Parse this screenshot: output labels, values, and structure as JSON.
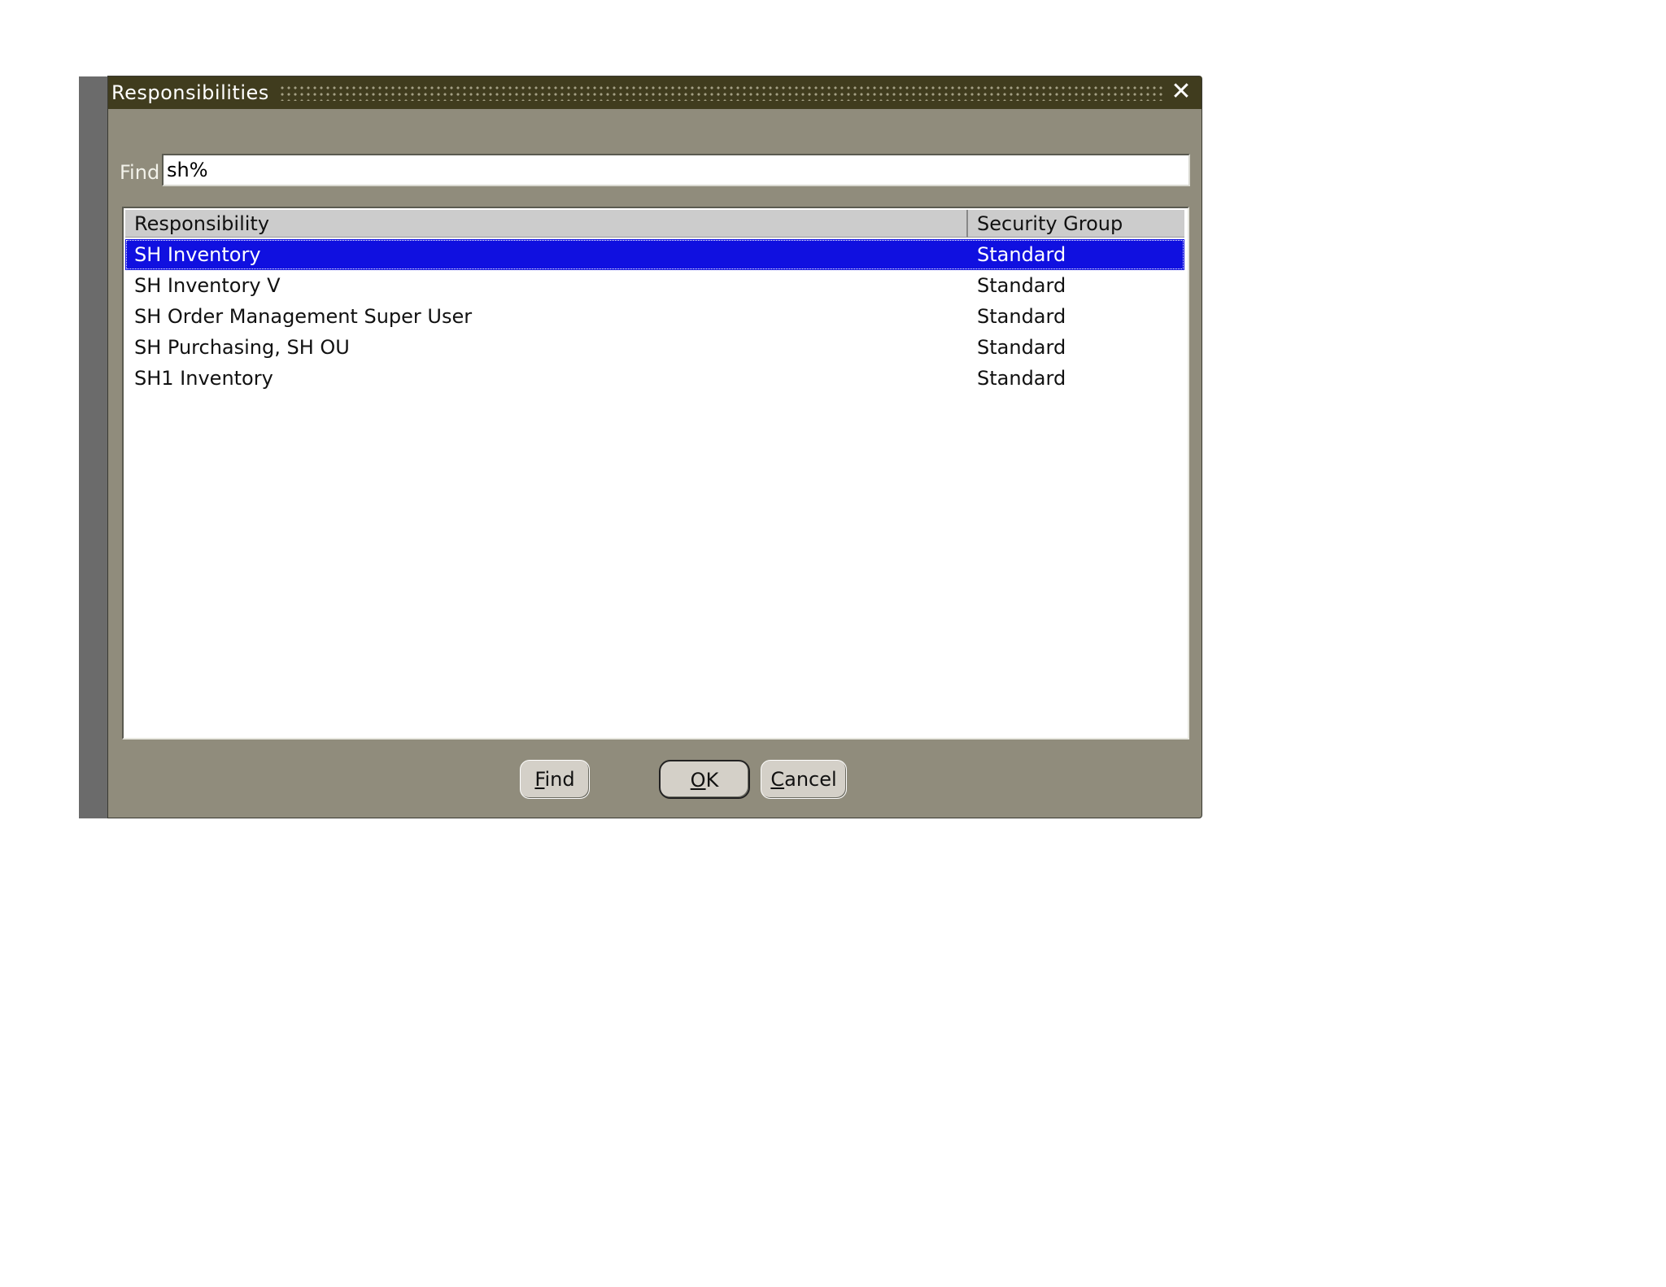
{
  "window": {
    "title": "Responsibilities",
    "close_glyph": "✕"
  },
  "find": {
    "label": "Find",
    "value": "sh%"
  },
  "table": {
    "columns": [
      "Responsibility",
      "Security Group"
    ],
    "rows": [
      {
        "responsibility": "SH Inventory",
        "security_group": "Standard",
        "selected": true
      },
      {
        "responsibility": "SH Inventory V",
        "security_group": "Standard",
        "selected": false
      },
      {
        "responsibility": "SH Order Management Super User",
        "security_group": "Standard",
        "selected": false
      },
      {
        "responsibility": "SH Purchasing, SH OU",
        "security_group": "Standard",
        "selected": false
      },
      {
        "responsibility": "SH1 Inventory",
        "security_group": "Standard",
        "selected": false
      }
    ]
  },
  "buttons": {
    "find": {
      "mnemonic": "F",
      "rest": "ind"
    },
    "ok": {
      "mnemonic": "O",
      "rest": "K"
    },
    "cancel": {
      "mnemonic": "C",
      "rest": "ancel"
    }
  },
  "colors": {
    "title_bar": "#403c1e",
    "window_bg": "#908c7c",
    "selection": "#1010e0"
  }
}
